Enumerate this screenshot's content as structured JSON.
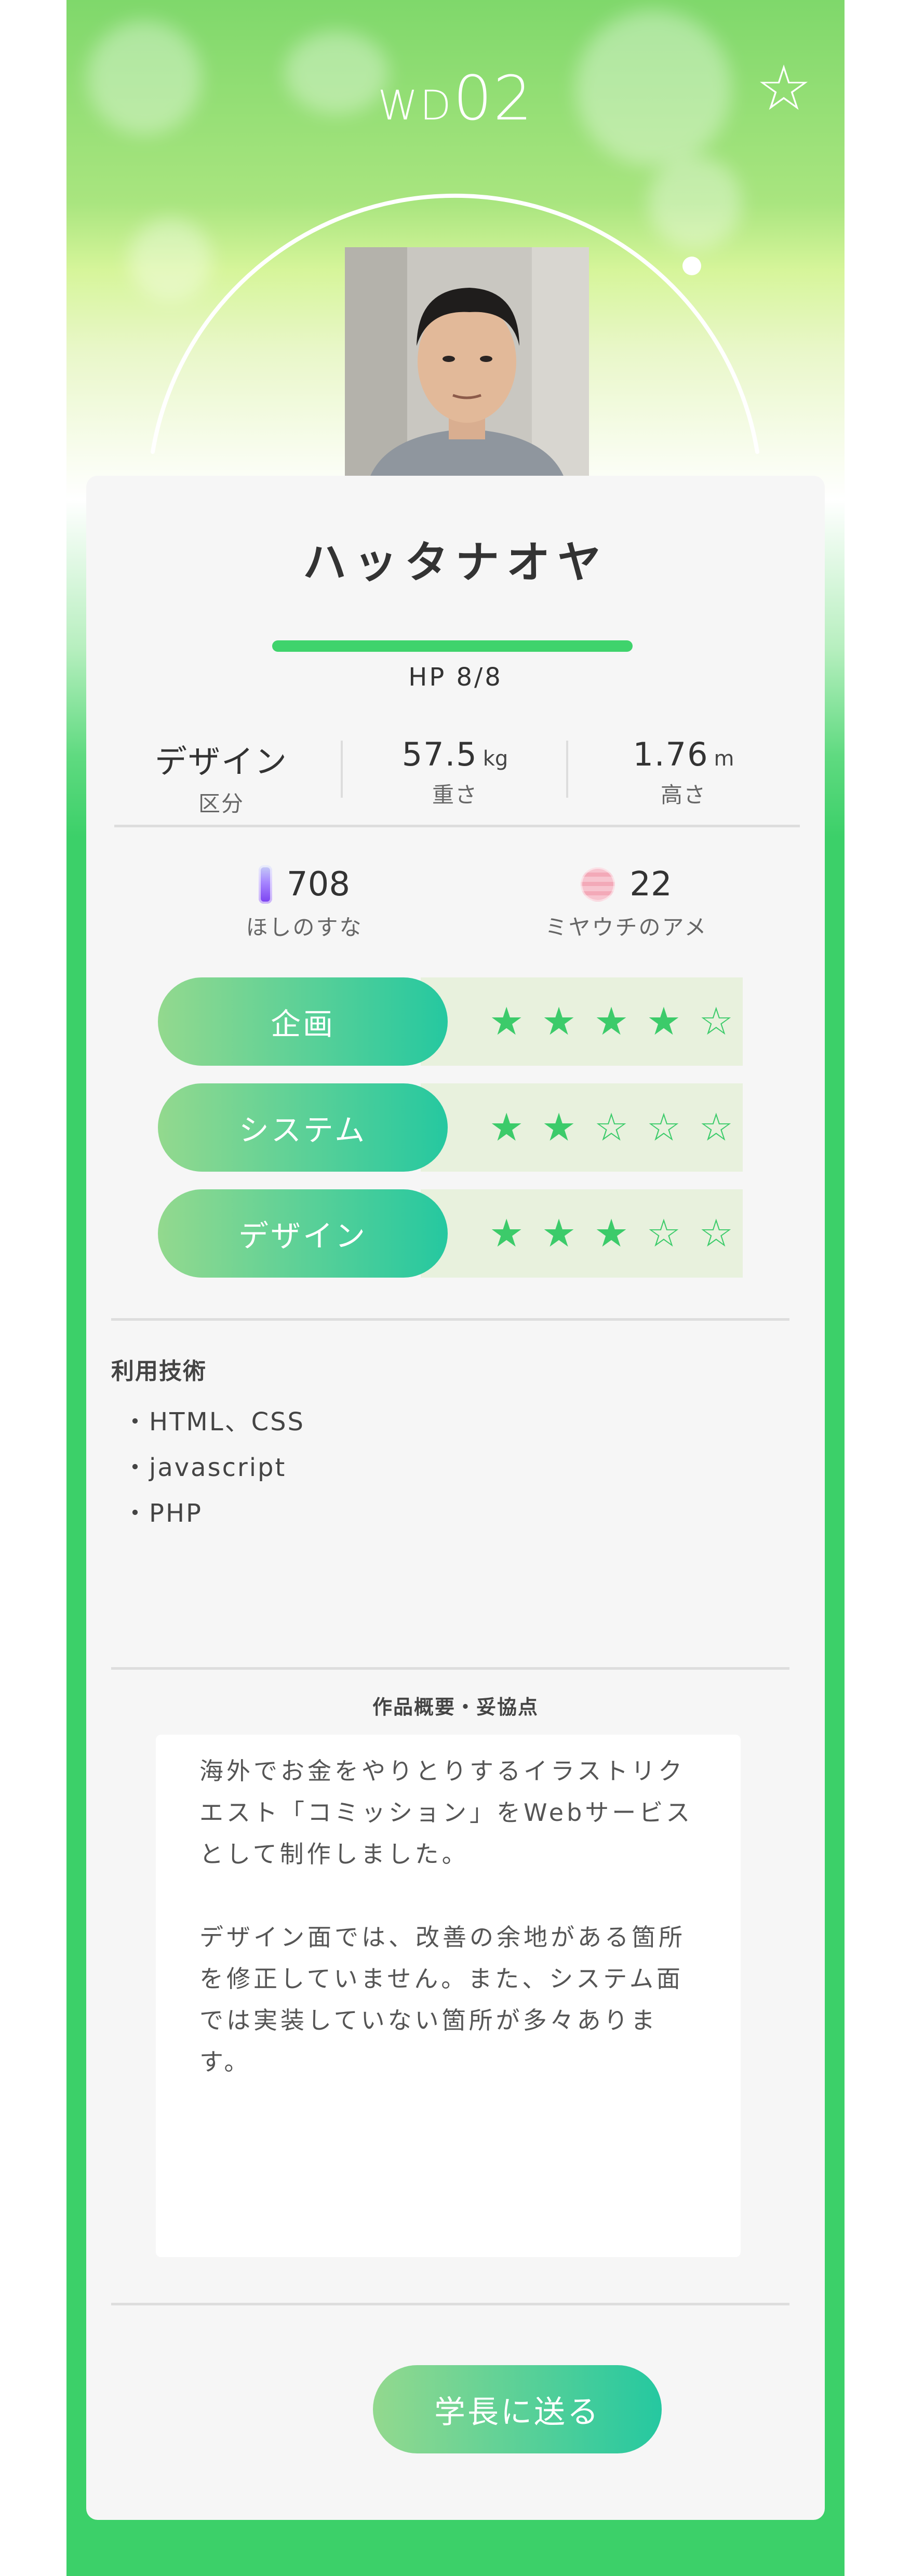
{
  "header": {
    "title_prefix": "WD",
    "title_number": "02",
    "favorite_icon": "star-outline-icon"
  },
  "profile": {
    "name": "ハッタナオヤ",
    "hp_text": "HP 8/8",
    "hp_fraction": 1.0
  },
  "stats": [
    {
      "value": "デザイン",
      "unit": "",
      "label": "区分"
    },
    {
      "value": "57.5",
      "unit": "kg",
      "label": "重さ"
    },
    {
      "value": "1.76",
      "unit": "m",
      "label": "高さ"
    }
  ],
  "items": [
    {
      "icon": "stardust-icon",
      "value": "708",
      "label": "ほしのすな"
    },
    {
      "icon": "candy-icon",
      "value": "22",
      "label": "ミヤウチのアメ"
    }
  ],
  "skills": [
    {
      "label": "企画",
      "rating": 4,
      "max": 5
    },
    {
      "label": "システム",
      "rating": 2,
      "max": 5
    },
    {
      "label": "デザイン",
      "rating": 3,
      "max": 5
    }
  ],
  "tech": {
    "title": "利用技術",
    "items": [
      "・HTML、CSS",
      "・javascript",
      "・PHP"
    ]
  },
  "summary": {
    "title": "作品概要・妥協点",
    "paragraphs": [
      "海外でお金をやりとりするイラストリクエスト「コミッション」をWebサービスとして制作しました。",
      "デザイン面では、改善の余地がある箇所を修正していません。また、システム面では実装していない箇所が多々あります。"
    ]
  },
  "actions": {
    "send_label": "学長に送る"
  },
  "colors": {
    "accent": "#3cd069",
    "pill_start": "#93d98e",
    "pill_end": "#25c8a0",
    "star": "#3ccb6a"
  }
}
